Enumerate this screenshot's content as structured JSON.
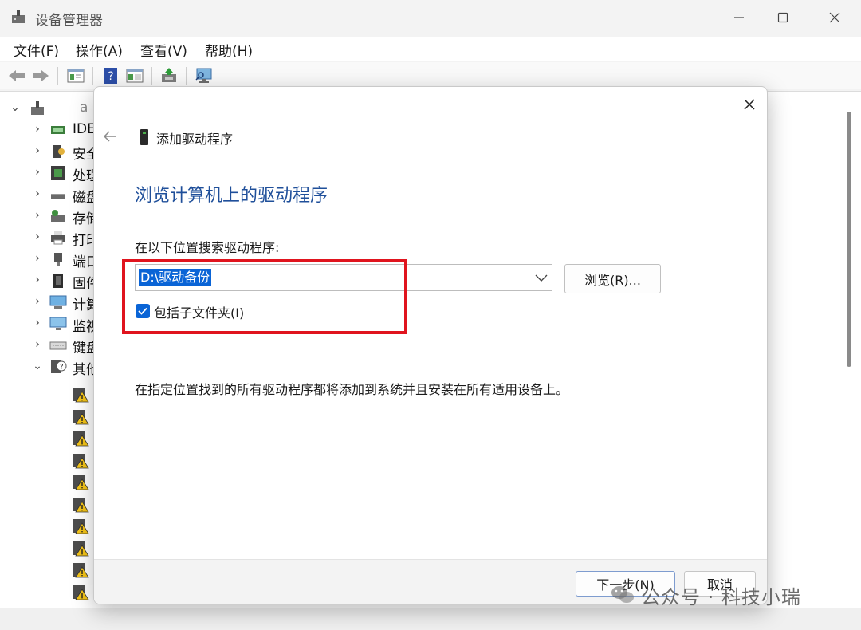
{
  "window": {
    "title": "设备管理器"
  },
  "menu": {
    "items": [
      "文件(F)",
      "操作(A)",
      "查看(V)",
      "帮助(H)"
    ]
  },
  "toolbar": {
    "icons": [
      "back-arrow-icon",
      "forward-arrow-icon",
      "properties-panel-icon",
      "help-icon",
      "view-panel-icon",
      "update-driver-icon",
      "monitor-scan-icon"
    ]
  },
  "tree": {
    "root_label": "a",
    "items": [
      {
        "label": "IDE",
        "icon": "ide-controller-icon"
      },
      {
        "label": "安全",
        "icon": "security-key-icon"
      },
      {
        "label": "处理",
        "icon": "processor-chip-icon"
      },
      {
        "label": "磁盘",
        "icon": "disk-drive-icon"
      },
      {
        "label": "存储",
        "icon": "storage-controller-icon"
      },
      {
        "label": "打印",
        "icon": "printer-icon"
      },
      {
        "label": "端口",
        "icon": "port-plug-icon"
      },
      {
        "label": "固件",
        "icon": "firmware-chip-icon"
      },
      {
        "label": "计算",
        "icon": "computer-icon"
      },
      {
        "label": "监视",
        "icon": "monitor-icon"
      },
      {
        "label": "键盘",
        "icon": "keyboard-icon"
      },
      {
        "label": "其他",
        "icon": "unknown-device-icon",
        "expanded": true
      }
    ],
    "warning_children_count": 10
  },
  "dialog": {
    "header_title": "添加驱动程序",
    "heading": "浏览计算机上的驱动程序",
    "search_label": "在以下位置搜索驱动程序:",
    "path_value": "D:\\驱动备份",
    "browse_label": "浏览(R)...",
    "include_subfolders_label": "包括子文件夹(I)",
    "include_subfolders_checked": true,
    "description": "在指定位置找到的所有驱动程序都将添加到系统并且安装在所有适用设备上。",
    "next_label": "下一步(N)",
    "cancel_label": "取消"
  },
  "watermark": {
    "text": "公众号 · 科技小瑞"
  },
  "colors": {
    "accent": "#0a64d6",
    "heading": "#1f4f9a",
    "highlight": "#e0141e"
  }
}
